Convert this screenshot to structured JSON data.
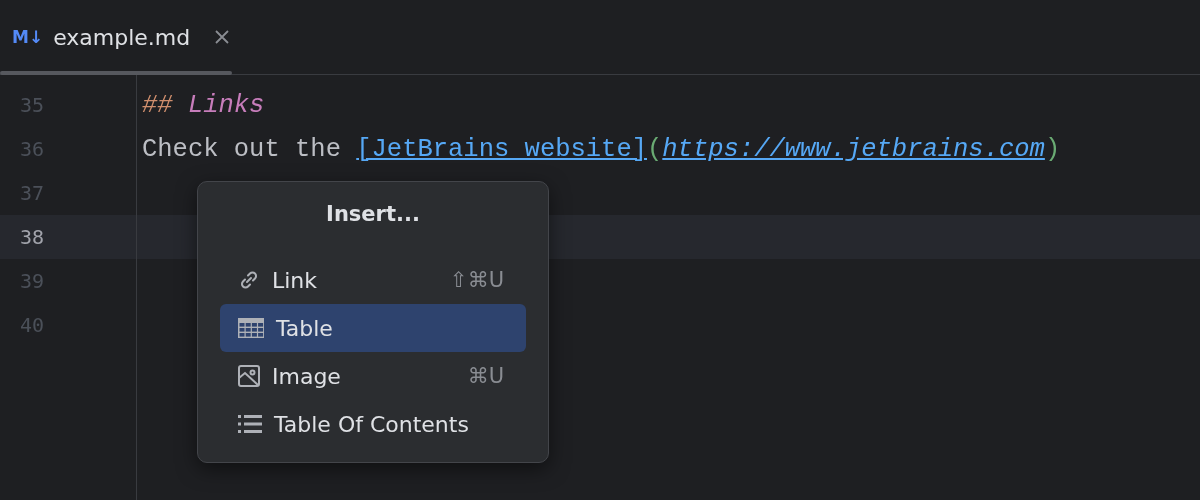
{
  "tab": {
    "icon_text": "M↓",
    "title": "example.md",
    "selected": true
  },
  "editor": {
    "lines": [
      {
        "number": "35",
        "current": false,
        "tokens": [
          {
            "kind": "heading-mark",
            "text": "##"
          },
          {
            "kind": "heading",
            "text": "Links"
          }
        ]
      },
      {
        "number": "36",
        "current": false,
        "tokens": [
          {
            "kind": "plain",
            "text": "Check out the "
          },
          {
            "kind": "link-text",
            "text": "[JetBrains website]"
          },
          {
            "kind": "paren",
            "text": "("
          },
          {
            "kind": "url",
            "text": "https://www.jetbrains.com"
          },
          {
            "kind": "paren",
            "text": ")"
          }
        ]
      },
      {
        "number": "37",
        "current": false
      },
      {
        "number": "38",
        "current": true
      },
      {
        "number": "39",
        "current": false
      },
      {
        "number": "40",
        "current": false
      }
    ]
  },
  "popup": {
    "title": "Insert...",
    "items": [
      {
        "kind": "link",
        "label": "Link",
        "shortcut": "⇧⌘U",
        "selected": false
      },
      {
        "kind": "table",
        "label": "Table",
        "selected": true
      },
      {
        "kind": "image",
        "label": "Image",
        "shortcut": "⌘U",
        "selected": false
      },
      {
        "kind": "toc",
        "label": "Table Of Contents",
        "selected": false
      }
    ]
  }
}
